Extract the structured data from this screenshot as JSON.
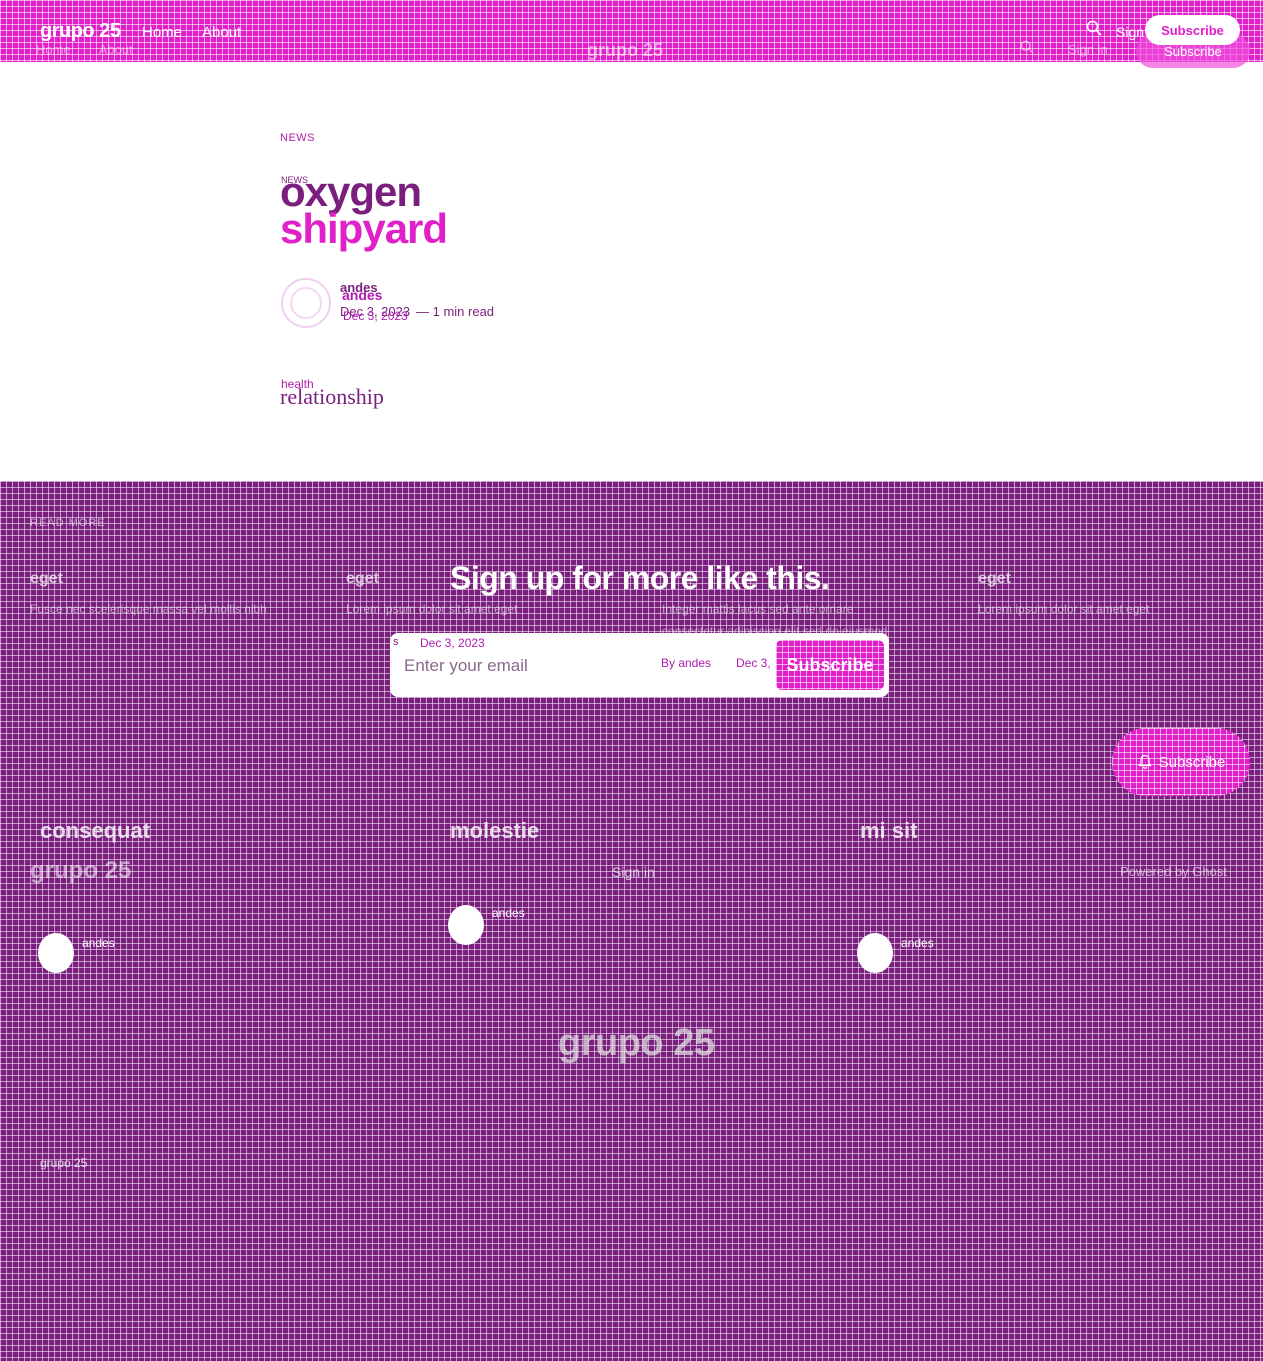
{
  "site": {
    "name": "grupo 25",
    "name_ghost": "grupo 25"
  },
  "header": {
    "nav": [
      "Home",
      "About"
    ],
    "nav_ghost": [
      "Home",
      "About"
    ],
    "signin": "Sign in",
    "signin_ghost": "Sign in",
    "subscribe": "Subscribe",
    "subscribe_ghost": "Subscribe"
  },
  "article": {
    "tag": "NEWS",
    "tag_ghost": "NEWS",
    "title_line1": "oxygen",
    "title_line2": "shipyard",
    "author": "andes",
    "author_ghost": "andes",
    "date": "Dec 3, 2023",
    "date_ghost": "Dec 3, 2023",
    "read_time": "— 1 min read",
    "body_ghost": "health",
    "body": "relationship"
  },
  "more": {
    "label": "READ MORE",
    "cards_ghost": [
      {
        "title": "eget",
        "text": "Fusce nec scelerisque massa vel mollis nibh"
      },
      {
        "title": "eget",
        "text": "Lorem ipsum dolor sit amet eget"
      },
      {
        "title": "eget",
        "text": "Lorem ipsum dolor sit amet eget"
      }
    ]
  },
  "signup": {
    "heading": "Sign up for more like this.",
    "sub": "Integer mattis lacus sed ante ornare",
    "sub2": "consectetur adipiscing elit sed do eiusmod",
    "date_ghost_a": "s",
    "date_ghost_b": "Dec 3, 2023",
    "email_placeholder": "Enter your email",
    "form_ghost_1": "By andes",
    "form_ghost_2": "Dec 3,",
    "button": "Subscribe",
    "float_button": "Subscribe"
  },
  "posts": [
    {
      "title": "consequat",
      "author": "andes"
    },
    {
      "title": "molestie",
      "author": "andes"
    },
    {
      "title": "mi sit",
      "author": "andes"
    }
  ],
  "footer": {
    "post_logo": "grupo 25",
    "signin": "Sign in",
    "powered": "Powered by Ghost",
    "logo": "grupo 25",
    "copyright": "grupo 25"
  },
  "colors": {
    "primary": "#7a1f7e",
    "accent": "#e020c8",
    "background": "#ffffff"
  }
}
